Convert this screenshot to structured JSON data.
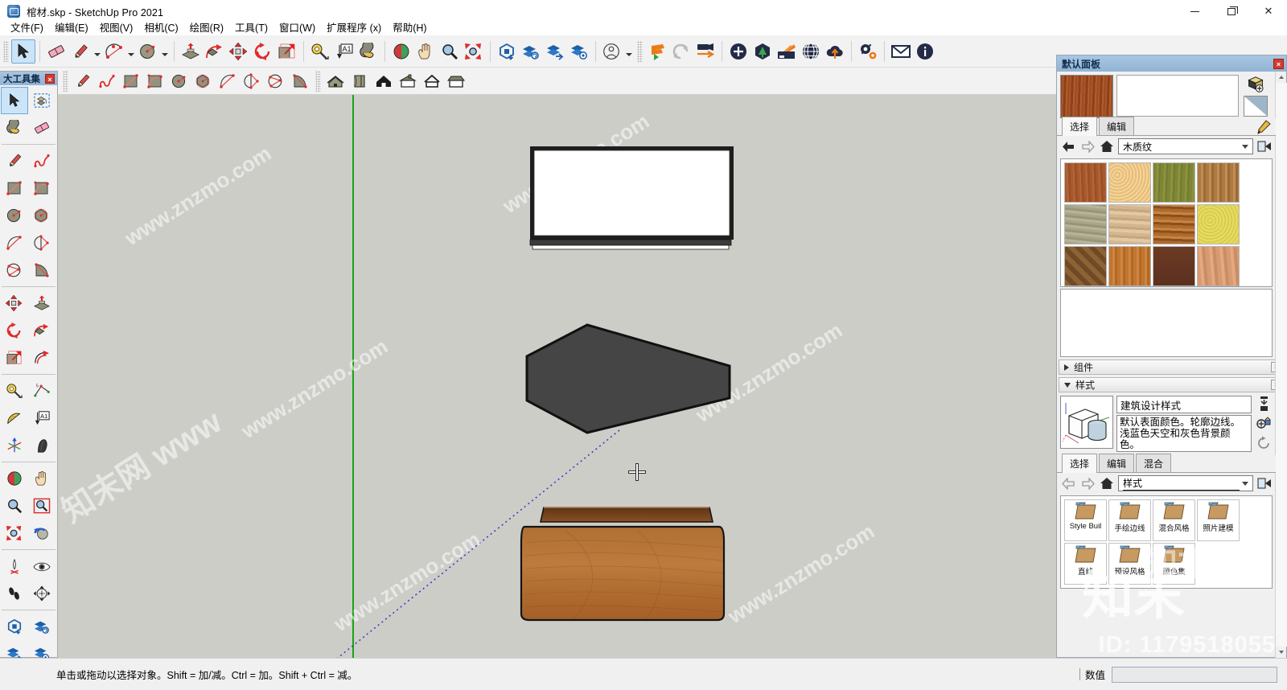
{
  "window": {
    "title": "棺材.skp - SketchUp Pro 2021",
    "app_icon": "sketchup-app-icon",
    "controls": {
      "minimize": "minimize-button",
      "restore": "restore-button",
      "close": "close-button"
    }
  },
  "menubar": {
    "items": [
      {
        "label": "文件(F)",
        "name": "menu-file"
      },
      {
        "label": "编辑(E)",
        "name": "menu-edit"
      },
      {
        "label": "视图(V)",
        "name": "menu-view"
      },
      {
        "label": "相机(C)",
        "name": "menu-camera"
      },
      {
        "label": "绘图(R)",
        "name": "menu-draw"
      },
      {
        "label": "工具(T)",
        "name": "menu-tools"
      },
      {
        "label": "窗口(W)",
        "name": "menu-window"
      },
      {
        "label": "扩展程序 (x)",
        "name": "menu-extensions"
      },
      {
        "label": "帮助(H)",
        "name": "menu-help"
      }
    ]
  },
  "toolbar_main": {
    "tools": [
      "select-tool",
      "eraser-tool",
      "line-tool",
      "arc-tool",
      "circle-tool",
      "push-pull-tool",
      "follow-me-tool",
      "move-tool",
      "rotate-tool",
      "scale-tool",
      "tape-measure-tool",
      "text-tool",
      "paint-bucket-tool",
      "orbit-tool",
      "pan-tool",
      "zoom-tool",
      "zoom-extents-tool",
      "trimble-model-icon",
      "trimble-sync-icon",
      "trimble-layers-icon",
      "trimble-settings-icon",
      "user-account-icon"
    ],
    "extensions": [
      "enscape-start-icon",
      "enscape-sync-icon",
      "enscape-video-icon",
      "enscape-add-icon",
      "enscape-asset-icon",
      "enscape-material-icon",
      "enscape-panorama-icon",
      "enscape-upload-icon",
      "enscape-settings-icon",
      "enscape-feedback-icon",
      "enscape-about-icon"
    ],
    "active": "select-tool"
  },
  "toolbar_secondary": {
    "tools": [
      "line-tool",
      "freehand-tool",
      "rectangle-tool",
      "rotated-rectangle-tool",
      "circle-tool",
      "polygon-tool",
      "arc-tool",
      "two-point-arc-tool",
      "three-point-arc-tool",
      "pie-tool",
      "style-house-1-icon",
      "style-box-icon",
      "style-house-2-icon",
      "style-house-3-icon",
      "style-house-4-icon",
      "style-house-5-icon"
    ]
  },
  "left_palette": {
    "title": "大工具集",
    "close": "×",
    "active": "select-tool",
    "tools": [
      "select-tool",
      "make-component-tool",
      "paint-bucket-tool",
      "eraser-tool",
      "line-tool",
      "freehand-tool",
      "rectangle-tool",
      "rotated-rectangle-tool",
      "circle-tool",
      "polygon-tool",
      "arc-tool",
      "two-point-arc-tool",
      "three-point-arc-tool",
      "pie-tool",
      "move-tool",
      "push-pull-tool",
      "rotate-tool",
      "follow-me-tool",
      "scale-tool",
      "offset-tool",
      "tape-measure-tool",
      "dimension-tool",
      "protractor-tool",
      "text-tool",
      "axes-tool",
      "3d-text-tool",
      "orbit-tool",
      "pan-tool",
      "zoom-tool",
      "zoom-window-tool",
      "zoom-extents-tool",
      "previous-view-tool",
      "position-camera-tool",
      "look-around-tool",
      "walk-tool",
      "section-plane-tool",
      "trimble-connect-tool",
      "trimble-manage-tool",
      "trimble-layers-tool",
      "trimble-settings-tool"
    ]
  },
  "canvas": {
    "background_color": "#cdcdc8",
    "axis_green_color": "#19a319",
    "axis_blue_color": "#3b3bc8",
    "cursor": "crosshair-cursor",
    "objects": [
      {
        "name": "coffin-lid-panel",
        "fill": "#ffffff",
        "edge": "#1c1c1c",
        "label": "coffin lid (top view, white face)"
      },
      {
        "name": "coffin-body-dark",
        "fill": "#454545",
        "edge": "#111111",
        "label": "coffin body (dark gray, selected face)"
      },
      {
        "name": "coffin-base-wood",
        "fill": "#b0672f",
        "edge": "#1c1c1c",
        "label": "coffin base with wood texture"
      }
    ],
    "watermarks": [
      "www.znzmo.com",
      "知末网 www.znzmo.com"
    ]
  },
  "tray": {
    "title": "默认面板",
    "close": "×",
    "materials": {
      "name_value": "",
      "preview_swatch": "wood-cherry-preview",
      "create_material_icon": "create-material-icon",
      "swatch_triangle_icon": "color-triangle-icon",
      "eyedropper_icon": "eyedropper-icon",
      "tabs": [
        {
          "label": "选择",
          "selected": true
        },
        {
          "label": "编辑",
          "selected": false
        }
      ],
      "nav": {
        "back_icon": "back-arrow-icon",
        "forward_icon": "forward-arrow-icon",
        "home_icon": "home-icon",
        "details_icon": "details-arrow-icon"
      },
      "collection": "木质纹",
      "swatches": [
        {
          "name": "wood-cherry-original",
          "color": "#a85a2d"
        },
        {
          "name": "wood-cork",
          "color": "#f1c98a"
        },
        {
          "name": "wood-bamboo-green",
          "color": "#7e8535"
        },
        {
          "name": "wood-floor-natural",
          "color": "#ae7a43"
        },
        {
          "name": "wood-driftwood-gray",
          "color": "#a9a58a"
        },
        {
          "name": "wood-floor-light",
          "color": "#d4b68e"
        },
        {
          "name": "wood-floor-dark-mixed",
          "color": "#b06b2c"
        },
        {
          "name": "wood-plywood-yellow",
          "color": "#e6d95a"
        },
        {
          "name": "wood-parquet",
          "color": "#8d6234"
        },
        {
          "name": "wood-board-orange",
          "color": "#c1762f"
        },
        {
          "name": "wood-dark-walnut",
          "color": "#6b3a23"
        },
        {
          "name": "wood-pine-pink",
          "color": "#d79a72"
        }
      ]
    },
    "sections": [
      {
        "label": "组件",
        "expanded": false,
        "name": "section-components"
      },
      {
        "label": "样式",
        "expanded": true,
        "name": "section-styles"
      }
    ],
    "styles": {
      "thumbnail": "style-preview-thumbnail",
      "style_name": "建筑设计样式",
      "style_description": "默认表面颜色。轮廓边线。浅蓝色天空和灰色背景颜色。",
      "side_icons": [
        "update-style-icon",
        "create-style-icon",
        "refresh-style-icon"
      ],
      "tabs": [
        {
          "label": "选择",
          "selected": true
        },
        {
          "label": "编辑",
          "selected": false
        },
        {
          "label": "混合",
          "selected": false
        }
      ],
      "nav": {
        "back_icon": "back-arrow-icon",
        "forward_icon": "forward-arrow-icon",
        "home_icon": "home-icon",
        "details_icon": "details-arrow-icon"
      },
      "collection": "样式",
      "folders": [
        {
          "label": "Style Buil",
          "name": "style-folder-style-builder"
        },
        {
          "label": "手绘边线",
          "name": "style-folder-sketchy-edges"
        },
        {
          "label": "混合风格",
          "name": "style-folder-mixed-styles"
        },
        {
          "label": "照片建模",
          "name": "style-folder-photo-modeling"
        },
        {
          "label": "直线",
          "name": "style-folder-straight-lines"
        },
        {
          "label": "预设风格",
          "name": "style-folder-preset-styles"
        },
        {
          "label": "颜色集",
          "name": "style-folder-color-sets"
        }
      ]
    },
    "scrollbar": {
      "up_icon": "scroll-up-icon",
      "down_icon": "scroll-down-icon"
    }
  },
  "statusbar": {
    "message": "单击或拖动以选择对象。Shift = 加/减。Ctrl = 加。Shift + Ctrl = 减。",
    "vcb_label": "数值",
    "vcb_value": "",
    "vcb_placeholder": ""
  },
  "overlays": {
    "id_watermark": "ID: 1179518055",
    "brand_watermark": "知末"
  },
  "colors": {
    "titlebar_bg": "#ffffff",
    "toolbar_bg": "#f2f2f2",
    "canvas_bg": "#cdcdc8",
    "tray_title_bg": "#9ec0de",
    "accent_select": "#cce4f7",
    "close_red": "#d63a2f",
    "axis_green": "#19a319",
    "axis_blue": "#3b3bc8",
    "wood_accent": "#a85a2d"
  }
}
